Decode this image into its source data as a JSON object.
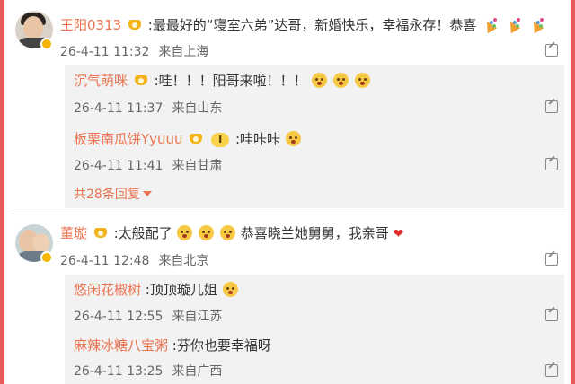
{
  "colors": {
    "frame": "#e85a5a",
    "username": "#eb7350",
    "meta": "#666666",
    "reply_bg": "#f2f2f2"
  },
  "comments": [
    {
      "username": "王阳0313",
      "text": ":最最好的“寝室六弟”达哥，新婚快乐，幸福永存！恭喜",
      "timestamp": "26-4-11 11:32",
      "location": "来自上海",
      "replies": [
        {
          "username": "沉气萌咪",
          "text": ":哇！！！阳哥来啦！！！",
          "timestamp": "26-4-11 11:37",
          "location": "来自山东"
        },
        {
          "username": "板栗南瓜饼Yyuuu",
          "badge": "I",
          "text": ":哇咔咔",
          "timestamp": "26-4-11 11:41",
          "location": "来自甘肃"
        }
      ],
      "more_replies": "共28条回复"
    },
    {
      "username": "董璇",
      "text_a": ":太般配了",
      "text_b": "恭喜晓兰她舅舅，我亲哥",
      "timestamp": "26-4-11 12:48",
      "location": "来自北京",
      "replies": [
        {
          "username": "悠闲花椒树",
          "text": ":顶顶璇儿姐",
          "timestamp": "26-4-11 12:55",
          "location": "来自江苏"
        },
        {
          "username": "麻辣冰糖八宝粥",
          "text": ":芬你也要幸福呀",
          "timestamp": "26-4-11 13:25",
          "location": "来自广西"
        }
      ]
    }
  ]
}
